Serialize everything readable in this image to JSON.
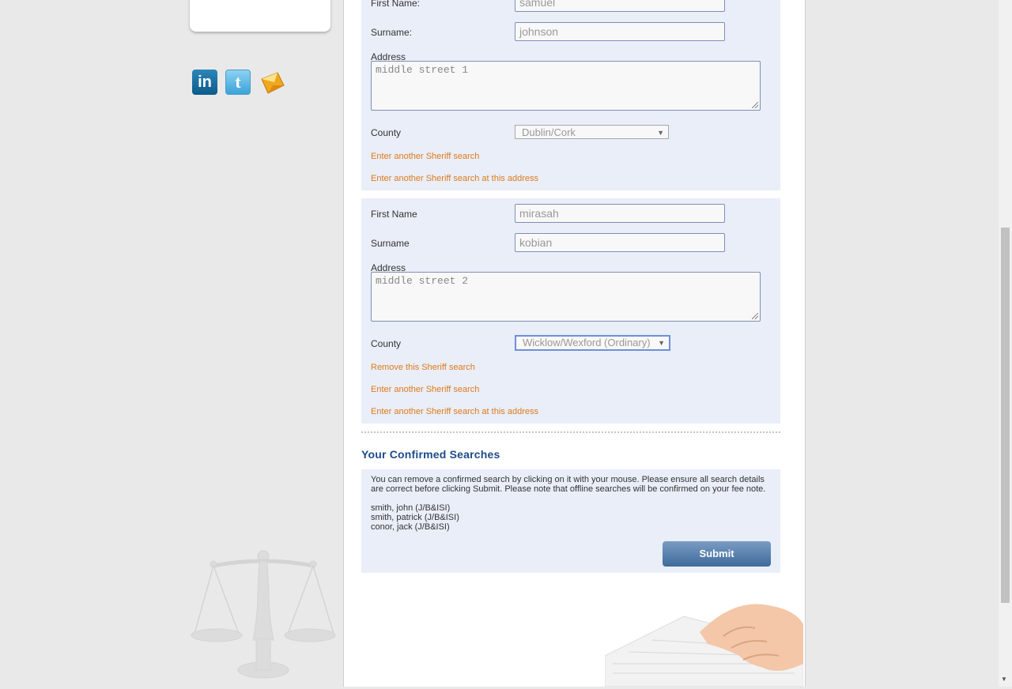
{
  "search1": {
    "first_name_label": "First Name:",
    "first_name_value": "samuel",
    "surname_label": "Surname:",
    "surname_value": "johnson",
    "address_label": "Address",
    "address_value": "middle street 1",
    "county_label": "County",
    "county_value": "Dublin/Cork",
    "link_another": "Enter another Sheriff search",
    "link_same_address": "Enter another Sheriff search at this address"
  },
  "search2": {
    "first_name_label": "First Name",
    "first_name_value": "mirasah",
    "surname_label": "Surname",
    "surname_value": "kobian",
    "address_label": "Address",
    "address_value": "middle street 2",
    "county_label": "County",
    "county_value": "Wicklow/Wexford (Ordinary)",
    "link_remove": "Remove this Sheriff search",
    "link_another": "Enter another Sheriff search",
    "link_same_address": "Enter another Sheriff search at this address"
  },
  "confirmed": {
    "heading": "Your Confirmed Searches",
    "instructions": "You can remove a confirmed search by clicking on it with your mouse. Please ensure all search details are correct before clicking Submit. Please note that offline searches will be confirmed on your fee note.",
    "items": [
      "smith, john (J/B&ISI)",
      "smith, patrick (J/B&ISI)",
      "conor, jack (J/B&ISI)"
    ],
    "submit_label": "Submit"
  },
  "social": {
    "linkedin": "in",
    "twitter": "t"
  },
  "colors": {
    "link": "#e07a1a",
    "heading": "#1c4b8c",
    "panel": "#e9eef8",
    "button": "#3e6a9b"
  },
  "icons": [
    "linkedin-icon",
    "twitter-icon",
    "email-icon",
    "scales-of-justice-icon",
    "select-arrow-icon"
  ]
}
